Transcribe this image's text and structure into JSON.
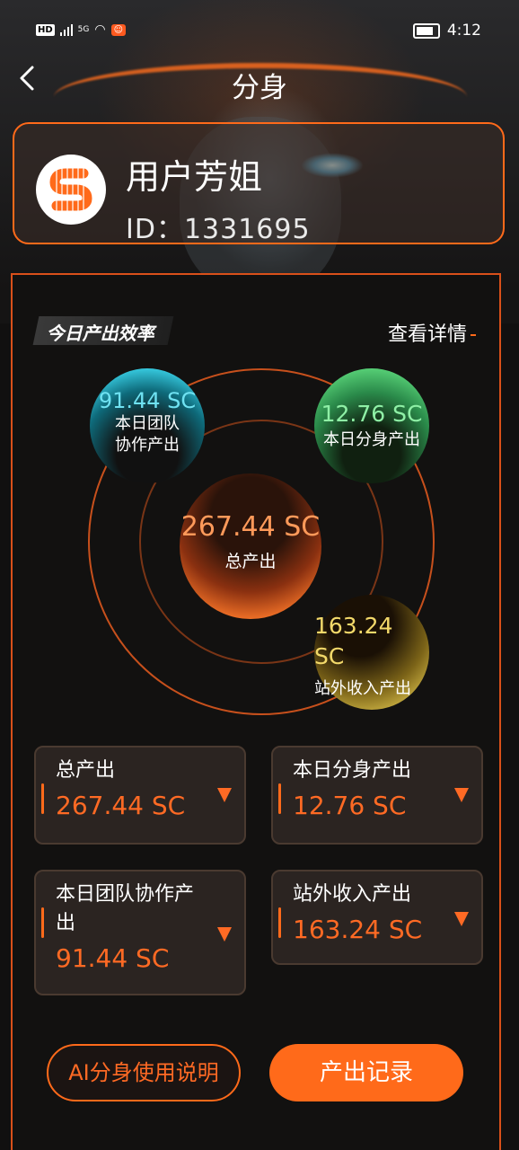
{
  "status_bar": {
    "network": "HD",
    "signal_type": "5G",
    "time": "4:12"
  },
  "nav": {
    "title": "分身"
  },
  "user": {
    "name": "用户芳姐",
    "id_text": "ID：1331695"
  },
  "efficiency": {
    "section_title": "今日产出效率",
    "details_link": "查看详情",
    "team_value": "91.44 SC",
    "team_label": "本日团队协作产出",
    "clone_value": "12.76 SC",
    "clone_label": "本日分身产出",
    "total_value": "267.44 SC",
    "total_label": "总产出",
    "external_value": "163.24 SC",
    "external_label": "站外收入产出"
  },
  "stats": [
    {
      "label": "总产出",
      "value": "267.44 SC"
    },
    {
      "label": "本日分身产出",
      "value": "12.76 SC"
    },
    {
      "label": "本日团队协作产出",
      "value": "91.44 SC"
    },
    {
      "label": "站外收入产出",
      "value": "163.24 SC"
    }
  ],
  "buttons": {
    "guide": "AI分身使用说明",
    "record": "产出记录"
  },
  "colors": {
    "accent": "#ff6a1a",
    "team": "#39d0e6",
    "clone": "#5fdc7e",
    "external": "#eacd59"
  },
  "icons": [
    "back-arrow-icon",
    "wifi-icon",
    "battery-icon",
    "signal-icon",
    "dropdown-arrow-icon",
    "brand-logo-icon"
  ]
}
